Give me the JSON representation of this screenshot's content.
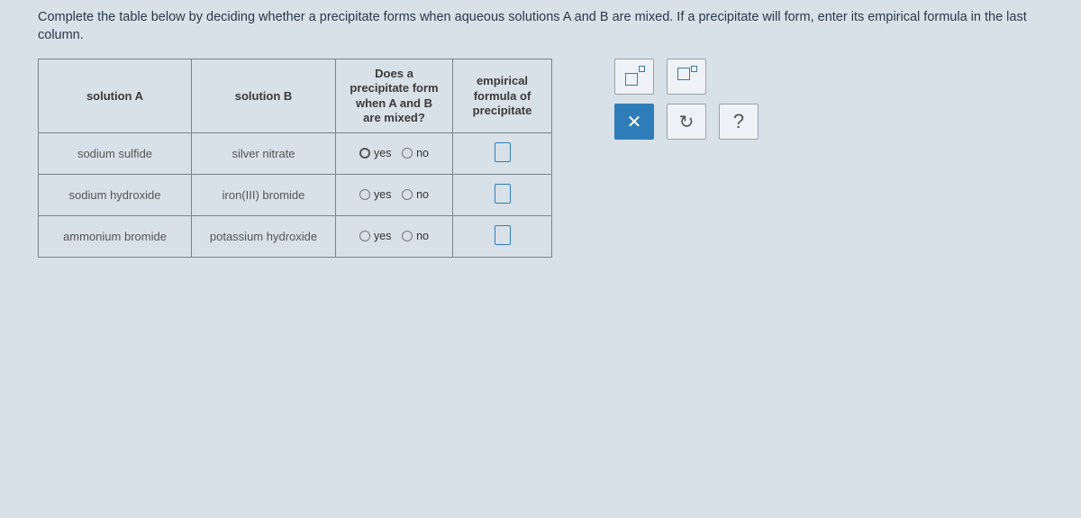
{
  "instructions": "Complete the table below by deciding whether a precipitate forms when aqueous solutions A and B are mixed. If a precipitate will form, enter its empirical formula in the last column.",
  "headers": {
    "a": "solution A",
    "b": "solution B",
    "c": "Does a precipitate form when A and B are mixed?",
    "d": "empirical formula of precipitate"
  },
  "labels": {
    "yes": "yes",
    "no": "no"
  },
  "rows": [
    {
      "a": "sodium sulfide",
      "b": "silver nitrate"
    },
    {
      "a": "sodium hydroxide",
      "b": "iron(III) bromide"
    },
    {
      "a": "ammonium bromide",
      "b": "potassium hydroxide"
    }
  ],
  "tool": {
    "x": "✕",
    "reset": "↻",
    "help": "?"
  }
}
